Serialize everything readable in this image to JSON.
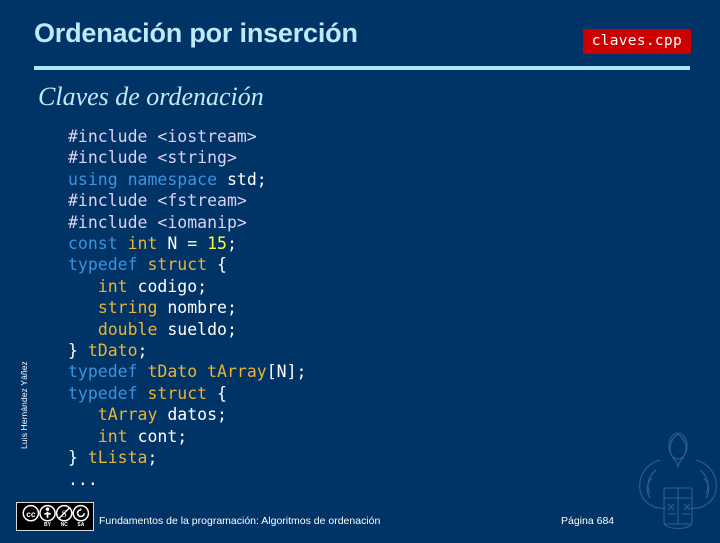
{
  "slide": {
    "title": "Ordenación por inserción",
    "subtitle": "Claves de ordenación",
    "file_badge": "claves.cpp",
    "accent_rule_color": "#aee6f5",
    "background_color": "#003366",
    "badge_color": "#cc0000"
  },
  "code": {
    "language": "cpp",
    "lines": [
      [
        {
          "t": "#include <iostream>",
          "c": "pre"
        }
      ],
      [
        {
          "t": "#include <string>",
          "c": "pre"
        }
      ],
      [
        {
          "t": "using namespace ",
          "c": "kw"
        },
        {
          "t": "std;",
          "c": "pl"
        }
      ],
      [
        {
          "t": "#include <fstream>",
          "c": "pre"
        }
      ],
      [
        {
          "t": "#include <iomanip>",
          "c": "pre"
        }
      ],
      [
        {
          "t": "const ",
          "c": "kw"
        },
        {
          "t": "int ",
          "c": "type"
        },
        {
          "t": "N = ",
          "c": "pl"
        },
        {
          "t": "15",
          "c": "num"
        },
        {
          "t": ";",
          "c": "pl"
        }
      ],
      [
        {
          "t": "typedef ",
          "c": "kw"
        },
        {
          "t": "struct ",
          "c": "type"
        },
        {
          "t": "{",
          "c": "pl"
        }
      ],
      [
        {
          "t": "   ",
          "c": "pl"
        },
        {
          "t": "int ",
          "c": "type"
        },
        {
          "t": "codigo;",
          "c": "pl"
        }
      ],
      [
        {
          "t": "   ",
          "c": "pl"
        },
        {
          "t": "string ",
          "c": "type"
        },
        {
          "t": "nombre;",
          "c": "pl"
        }
      ],
      [
        {
          "t": "   ",
          "c": "pl"
        },
        {
          "t": "double ",
          "c": "type"
        },
        {
          "t": "sueldo;",
          "c": "pl"
        }
      ],
      [
        {
          "t": "} ",
          "c": "pl"
        },
        {
          "t": "tDato",
          "c": "type"
        },
        {
          "t": ";",
          "c": "pl"
        }
      ],
      [
        {
          "t": "typedef ",
          "c": "kw"
        },
        {
          "t": "tDato tArray",
          "c": "type"
        },
        {
          "t": "[N];",
          "c": "pl"
        }
      ],
      [
        {
          "t": "typedef ",
          "c": "kw"
        },
        {
          "t": "struct ",
          "c": "type"
        },
        {
          "t": "{",
          "c": "pl"
        }
      ],
      [
        {
          "t": "   ",
          "c": "pl"
        },
        {
          "t": "tArray ",
          "c": "type"
        },
        {
          "t": "datos;",
          "c": "pl"
        }
      ],
      [
        {
          "t": "   ",
          "c": "pl"
        },
        {
          "t": "int ",
          "c": "type"
        },
        {
          "t": "cont;",
          "c": "pl"
        }
      ],
      [
        {
          "t": "} ",
          "c": "pl"
        },
        {
          "t": "tLista",
          "c": "type"
        },
        {
          "t": ";",
          "c": "pl"
        }
      ],
      [
        {
          "t": "...",
          "c": "pl"
        }
      ]
    ]
  },
  "author": {
    "name": "Luis Hernández Yáñez"
  },
  "footer": {
    "license_badge": "CC BY-NC-SA",
    "license_marks": [
      "BY",
      "NC",
      "SA"
    ],
    "caption": "Fundamentos de la programación: Algoritmos de ordenación",
    "page_label": "Página 684"
  }
}
